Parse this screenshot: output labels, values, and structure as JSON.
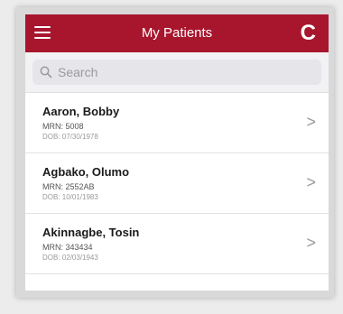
{
  "header": {
    "title": "My Patients",
    "menu_icon": "hamburger-menu-icon",
    "refresh_icon": "refresh-icon",
    "refresh_glyph": "C",
    "color": "#a8162e"
  },
  "search": {
    "placeholder": "Search",
    "value": "",
    "icon": "search-icon"
  },
  "patients": [
    {
      "name": "Aaron, Bobby",
      "mrn": "MRN: 5008",
      "dob": "DOB: 07/30/1978"
    },
    {
      "name": "Agbako, Olumo",
      "mrn": "MRN: 2552AB",
      "dob": "DOB: 10/01/1983"
    },
    {
      "name": "Akinnagbe, Tosin",
      "mrn": "MRN: 343434",
      "dob": "DOB: 02/03/1943"
    }
  ],
  "row_chevron": ">"
}
